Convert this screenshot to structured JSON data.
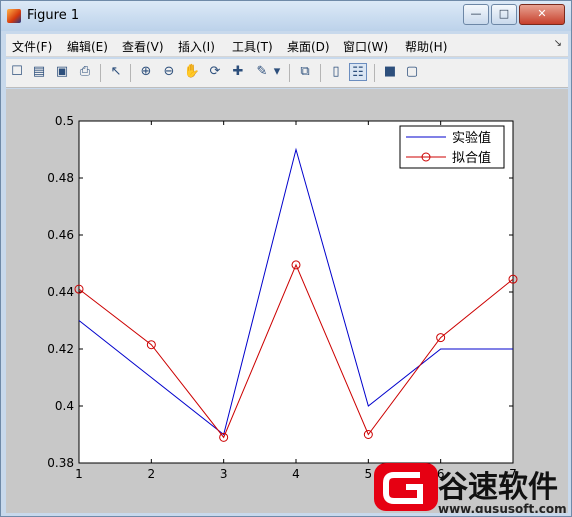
{
  "window": {
    "title": "Figure 1",
    "minimize": "—",
    "maximize": "□",
    "close": "✕"
  },
  "menu": [
    "文件(F)",
    "编辑(E)",
    "查看(V)",
    "插入(I)",
    "工具(T)",
    "桌面(D)",
    "窗口(W)",
    "帮助(H)"
  ],
  "menu_overflow": "↘",
  "toolbar": [
    {
      "name": "new-figure-icon",
      "glyph": "☐"
    },
    {
      "name": "open-file-icon",
      "glyph": "▤"
    },
    {
      "name": "save-icon",
      "glyph": "▣"
    },
    {
      "name": "print-icon",
      "glyph": "⎙"
    },
    {
      "name": "pointer-icon",
      "glyph": "↖"
    },
    {
      "name": "zoom-in-icon",
      "glyph": "⊕"
    },
    {
      "name": "zoom-out-icon",
      "glyph": "⊖"
    },
    {
      "name": "pan-hand-icon",
      "glyph": "✋"
    },
    {
      "name": "rotate-3d-icon",
      "glyph": "⟳"
    },
    {
      "name": "data-cursor-icon",
      "glyph": "✚"
    },
    {
      "name": "brush-icon",
      "glyph": "✎"
    },
    {
      "name": "brush-dropdown-icon",
      "glyph": "▾"
    },
    {
      "name": "link-plot-icon",
      "glyph": "⧉"
    },
    {
      "name": "colorbar-icon",
      "glyph": "▯"
    },
    {
      "name": "legend-icon",
      "glyph": "☷"
    },
    {
      "name": "hide-plot-tools-icon",
      "glyph": "■"
    },
    {
      "name": "show-plot-tools-icon",
      "glyph": "▢"
    }
  ],
  "colors": {
    "series_experimental": "#0000cc",
    "series_fitted": "#cc0000",
    "figure_background": "#c8c8c8"
  },
  "chart_data": {
    "type": "line",
    "title": "",
    "xlabel": "",
    "ylabel": "",
    "x": [
      1,
      2,
      3,
      4,
      5,
      6,
      7
    ],
    "xlim": [
      1,
      7
    ],
    "ylim": [
      0.38,
      0.5
    ],
    "xticks": [
      "1",
      "2",
      "3",
      "4",
      "5",
      "6",
      "7"
    ],
    "yticks": [
      "0.38",
      "0.4",
      "0.42",
      "0.44",
      "0.46",
      "0.48",
      "0.5"
    ],
    "grid": false,
    "legend_position": "top-right",
    "series": [
      {
        "name": "实验值",
        "values": [
          0.43,
          0.41,
          0.39,
          0.49,
          0.4,
          0.42,
          0.42
        ],
        "color": "#0000cc",
        "marker": "none"
      },
      {
        "name": "拟合值",
        "values": [
          0.441,
          0.4215,
          0.389,
          0.4495,
          0.39,
          0.424,
          0.4445
        ],
        "color": "#cc0000",
        "marker": "circle"
      }
    ]
  },
  "watermark": {
    "brand": "谷速软件",
    "url": "www.gususoft.com"
  }
}
